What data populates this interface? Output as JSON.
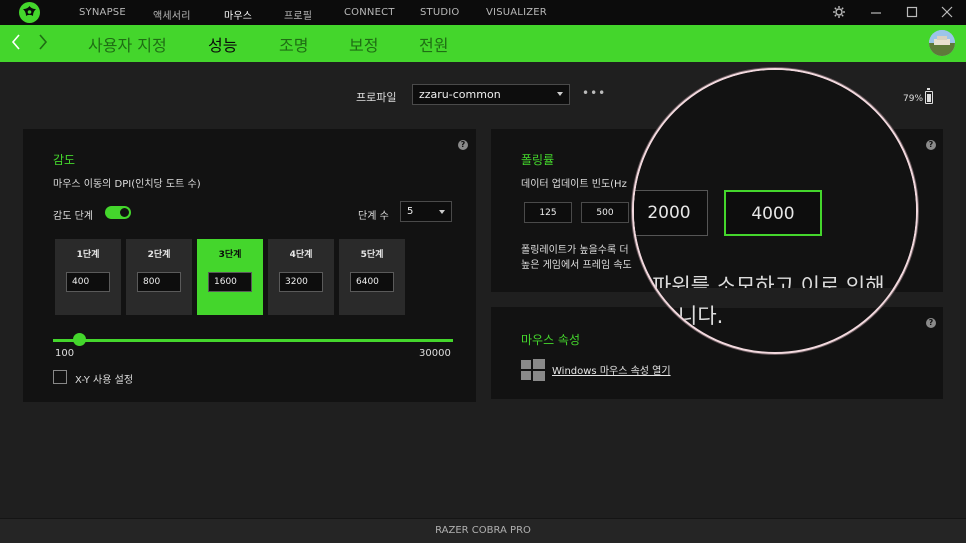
{
  "topnav": {
    "items": [
      "SYNAPSE",
      "액세서리",
      "마우스",
      "프로필",
      "CONNECT",
      "STUDIO",
      "VISUALIZER"
    ],
    "active": "마우스"
  },
  "subnav": {
    "items": [
      "사용자 지정",
      "성능",
      "조명",
      "보정",
      "전원"
    ],
    "active": "성능"
  },
  "profile": {
    "label": "프로파일",
    "value": "zzaru-common"
  },
  "battery": {
    "percent_label": "79%",
    "level": 0.79
  },
  "sensitivity": {
    "title": "감도",
    "subtitle": "마우스 이동의 DPI(인치당 도트 수)",
    "stages_label": "감도 단계",
    "stages_enabled": true,
    "count_label": "단계 수",
    "count_value": "5",
    "stages": [
      {
        "label": "1단계",
        "value": "400"
      },
      {
        "label": "2단계",
        "value": "800"
      },
      {
        "label": "3단계",
        "value": "1600"
      },
      {
        "label": "4단계",
        "value": "3200"
      },
      {
        "label": "5단계",
        "value": "6400"
      }
    ],
    "active_stage": 3,
    "slider_min": "100",
    "slider_max": "30000",
    "slider_value": 1600,
    "xy_label": "X-Y 사용 설정",
    "xy_checked": false
  },
  "polling": {
    "title": "폴링률",
    "subtitle": "데이터 업데이트 빈도(Hz",
    "rates": [
      "125",
      "500",
      "2000",
      "4000"
    ],
    "selected": "4000",
    "desc_line1": "폴링레이트가 높을수록 더",
    "desc_line2": "높은 게임에서 프레임 속도",
    "magnified_line1": "파워를 소모하고 이로 인해",
    "magnified_line2": "니다."
  },
  "mouse_properties": {
    "title": "마우스 속성",
    "link": "Windows 마우스 속성 열기"
  },
  "help_glyph": "?",
  "more_glyph": "•••",
  "footer": {
    "device": "RAZER COBRA PRO"
  },
  "colors": {
    "accent": "#44d62c",
    "background": "#1f1f1f",
    "panel": "#121212"
  },
  "icons": [
    "razer-logo-icon",
    "gear-icon",
    "minimize-icon",
    "maximize-icon",
    "close-icon",
    "back-arrow-icon",
    "forward-arrow-icon",
    "battery-icon",
    "help-icon",
    "windows-logo-icon"
  ]
}
